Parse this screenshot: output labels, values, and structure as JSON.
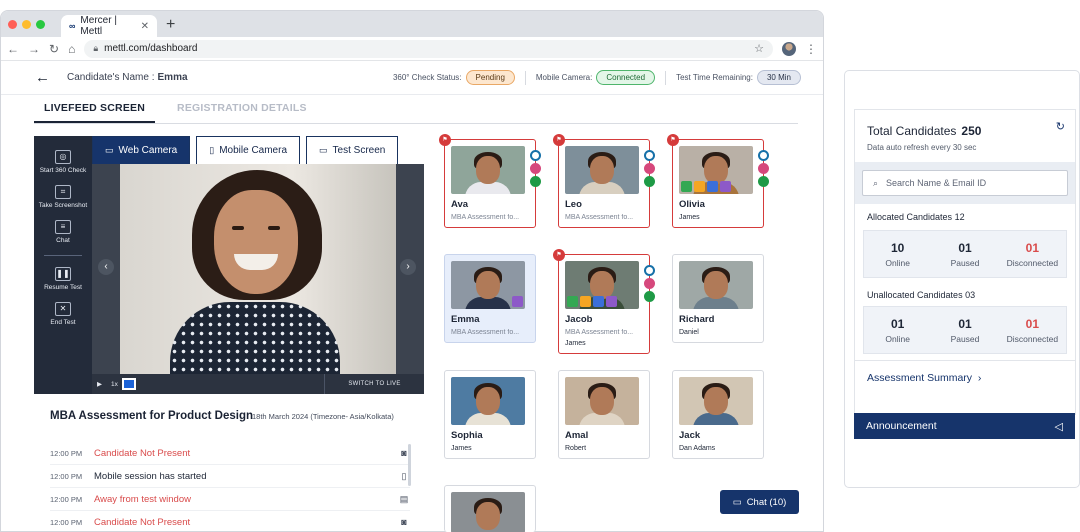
{
  "browser": {
    "tab_title": "Mercer | Mettl",
    "url": "mettl.com/dashboard",
    "favicon_text": "∞"
  },
  "header": {
    "candidate_label": "Candidate's Name :",
    "candidate_name": "Emma",
    "check_status_label": "360° Check Status:",
    "check_status_value": "Pending",
    "mobile_camera_label": "Mobile Camera:",
    "mobile_camera_value": "Connected",
    "time_label": "Test Time Remaining:",
    "time_value": "30 Min"
  },
  "tabs": {
    "livefeed": "LIVEFEED SCREEN",
    "registration": "REGISTRATION DETAILS"
  },
  "tools": [
    {
      "label": "Start 360 Check",
      "icon": "360-icon"
    },
    {
      "label": "Take Screenshot",
      "icon": "screenshot-icon"
    },
    {
      "label": "Chat",
      "icon": "chat-icon"
    },
    {
      "label": "Resume Test",
      "icon": "pause-icon"
    },
    {
      "label": "End Test",
      "icon": "close-icon"
    }
  ],
  "camera_tabs": {
    "web": "Web Camera",
    "mobile": "Mobile Camera",
    "screen": "Test Screen"
  },
  "controls": {
    "speed": "1x",
    "switch_live": "SWITCH TO LIVE"
  },
  "assessment": {
    "title": "MBA Assessment for Product Design",
    "date": "18th March 2024 (Timezone- Asia/Kolkata)",
    "log": [
      {
        "time": "12:00 PM",
        "text": "Candidate Not Present",
        "icon": "camera-icon"
      },
      {
        "time": "12:00 PM",
        "text": "Mobile session has started",
        "icon": "mobile-icon"
      },
      {
        "time": "12:00 PM",
        "text": "Away from test window",
        "icon": "window-icon"
      },
      {
        "time": "12:00 PM",
        "text": "Candidate Not Present",
        "icon": "camera-icon"
      }
    ]
  },
  "candidates": [
    {
      "name": "Ava",
      "sub": "MBA Assessment fo...",
      "sub2": ""
    },
    {
      "name": "Leo",
      "sub": "MBA Assessment fo...",
      "sub2": ""
    },
    {
      "name": "Olivia",
      "sub": "",
      "sub2": "James"
    },
    {
      "name": "Emma",
      "sub": "MBA Assessment fo...",
      "sub2": ""
    },
    {
      "name": "Jacob",
      "sub": "MBA Assessment fo...",
      "sub2": "James"
    },
    {
      "name": "Richard",
      "sub": "",
      "sub2": "Daniel"
    },
    {
      "name": "Sophia",
      "sub": "",
      "sub2": "James"
    },
    {
      "name": "Amal",
      "sub": "",
      "sub2": "Robert"
    },
    {
      "name": "Jack",
      "sub": "",
      "sub2": "Dan Adams"
    }
  ],
  "chat_button": "Chat (10)",
  "panel": {
    "total_label": "Total Candidates",
    "total_value": "250",
    "auto_refresh": "Data auto refresh every 30 sec",
    "search_placeholder": "Search Name & Email ID",
    "allocated_label": "Allocated Candidates",
    "allocated_count": "12",
    "allocated": [
      {
        "n": "10",
        "l": "Online"
      },
      {
        "n": "01",
        "l": "Paused"
      },
      {
        "n": "01",
        "l": "Disconnected"
      }
    ],
    "unallocated_label": "Unallocated Candidates",
    "unallocated_count": "03",
    "unallocated": [
      {
        "n": "01",
        "l": "Online"
      },
      {
        "n": "01",
        "l": "Paused"
      },
      {
        "n": "01",
        "l": "Disconnected"
      }
    ],
    "summary": "Assessment Summary",
    "announcement": "Announcement"
  },
  "colors": {
    "brand_navy": "#16346b",
    "alert_red": "#d94b4b",
    "pending_orange": "#e9a866",
    "connected_green": "#4fb56c"
  }
}
